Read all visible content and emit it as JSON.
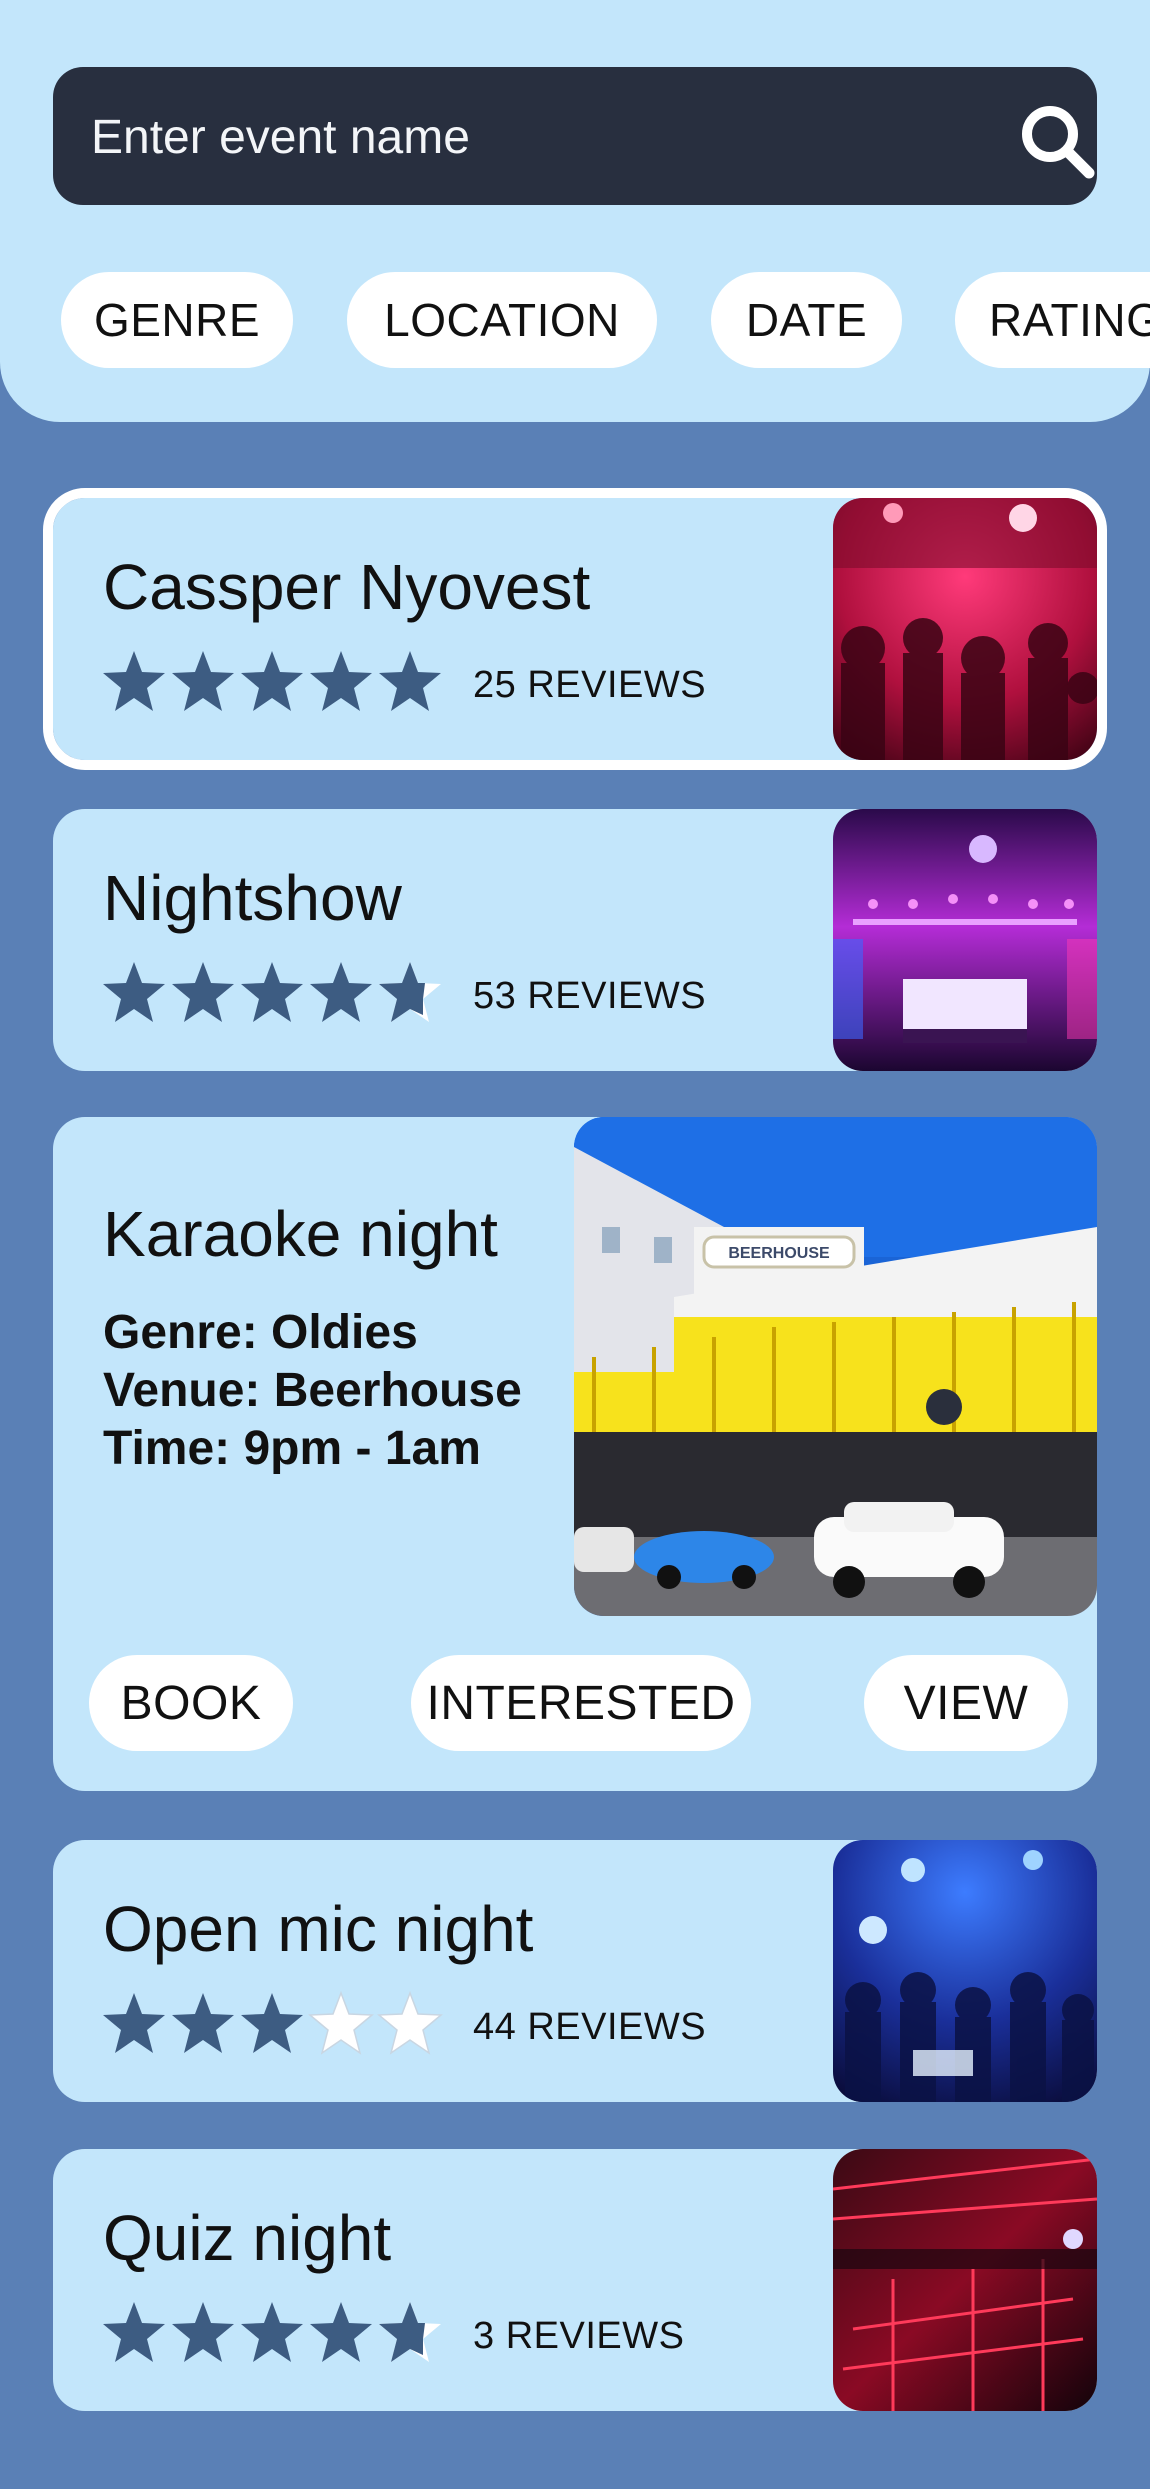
{
  "search": {
    "placeholder": "Enter event name",
    "icon": "search-icon"
  },
  "filters": [
    {
      "label": "GENRE"
    },
    {
      "label": "LOCATION"
    },
    {
      "label": "DATE"
    },
    {
      "label": "RATING"
    }
  ],
  "events": [
    {
      "title": "Cassper Nyovest",
      "rating": 5,
      "reviews": "25 REVIEWS",
      "selected": true
    },
    {
      "title": "Nightshow",
      "rating": 4.5,
      "reviews": "53 REVIEWS"
    },
    {
      "title": "Open mic night",
      "rating": 3,
      "reviews": "44 REVIEWS"
    },
    {
      "title": "Quiz night",
      "rating": 4.5,
      "reviews": "3 REVIEWS"
    }
  ],
  "featured": {
    "title": "Karaoke night",
    "genre": "Genre: Oldies",
    "venue": "Venue: Beerhouse",
    "time": "Time: 9pm - 1am",
    "sign": "BEERHOUSE",
    "actions": {
      "book": "BOOK",
      "interested": "INTERESTED",
      "view": "VIEW"
    }
  },
  "colors": {
    "background": "#5a80b6",
    "card": "#c3e6fb",
    "search_bar": "#282f3f",
    "star_filled": "#3d5c82",
    "star_empty": "#ffffff"
  }
}
